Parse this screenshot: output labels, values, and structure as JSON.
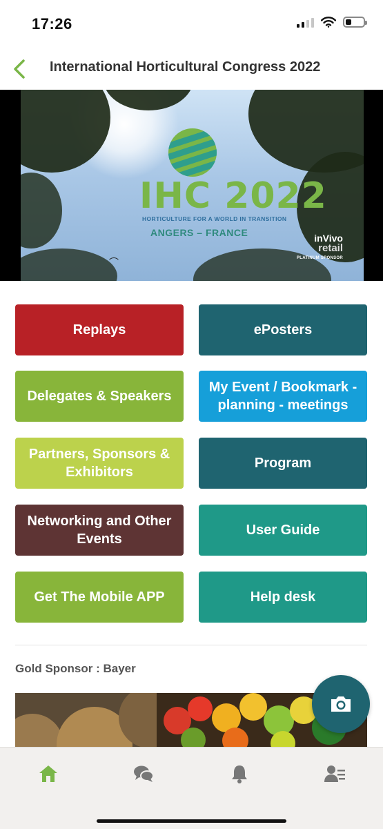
{
  "status_bar": {
    "time": "17:26",
    "battery_level": 0.35
  },
  "header": {
    "title": "International Horticultural Congress 2022",
    "back_icon": "chevron-left-icon"
  },
  "banner": {
    "logo_title": "IHC 2022",
    "logo_subtitle": "HORTICULTURE FOR A WORLD IN TRANSITION",
    "location": "ANGERS – FRANCE",
    "sponsor_brand_1": "inVivo",
    "sponsor_brand_2": "retail",
    "sponsor_tag": "PLATINUM SPONSOR"
  },
  "menu": {
    "buttons": [
      {
        "label": "Replays",
        "color": "#b82126"
      },
      {
        "label": "ePosters",
        "color": "#1f6470"
      },
      {
        "label": "Delegates & Speakers",
        "color": "#88b53a"
      },
      {
        "label": "My Event / Bookmark - planning - meetings",
        "color": "#169fd9"
      },
      {
        "label": "Partners, Sponsors & Exhibitors",
        "color": "#bcd24c"
      },
      {
        "label": "Program",
        "color": "#1f6470"
      },
      {
        "label": "Networking and Other Events",
        "color": "#5e3434"
      },
      {
        "label": "User Guide",
        "color": "#1f9988"
      },
      {
        "label": "Get The Mobile APP",
        "color": "#88b53a"
      },
      {
        "label": "Help desk",
        "color": "#1f9988"
      }
    ]
  },
  "sponsor": {
    "label": "Gold Sponsor : Bayer"
  },
  "fab": {
    "icon": "camera-icon",
    "color": "#1f6470"
  },
  "tab_bar": {
    "items": [
      {
        "icon": "home-icon",
        "active": true
      },
      {
        "icon": "chat-icon",
        "active": false
      },
      {
        "icon": "bell-icon",
        "active": false
      },
      {
        "icon": "profile-list-icon",
        "active": false
      }
    ],
    "active_color": "#7ab648",
    "inactive_color": "#777777"
  }
}
